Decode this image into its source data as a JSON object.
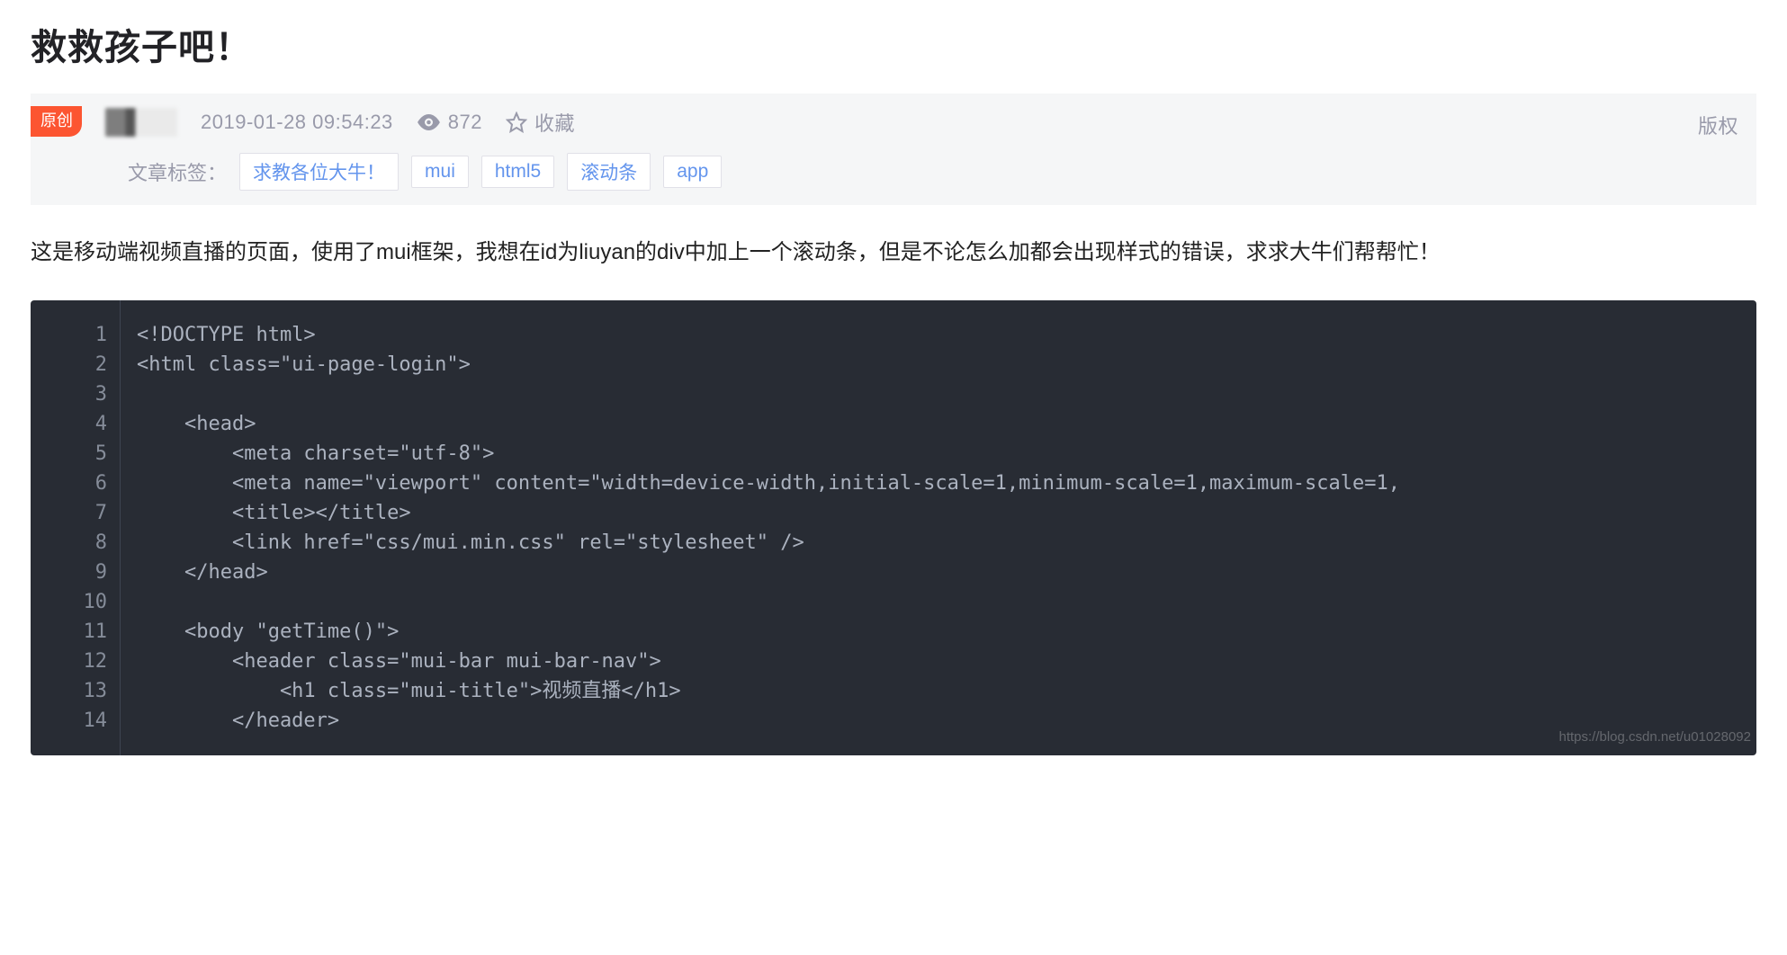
{
  "title": "救救孩子吧！",
  "meta": {
    "badge": "原创",
    "timestamp": "2019-01-28 09:54:23",
    "views": "872",
    "fav": "收藏",
    "copyright": "版权",
    "tags_label": "文章标签：",
    "tags": [
      "求教各位大牛！",
      "mui",
      "html5",
      "滚动条",
      "app"
    ]
  },
  "body": "这是移动端视频直播的页面，使用了mui框架，我想在id为liuyan的div中加上一个滚动条，但是不论怎么加都会出现样式的错误，求求大牛们帮帮忙！",
  "code": {
    "lines": [
      "<!DOCTYPE html>",
      "<html class=\"ui-page-login\">",
      "",
      "    <head>",
      "        <meta charset=\"utf-8\">",
      "        <meta name=\"viewport\" content=\"width=device-width,initial-scale=1,minimum-scale=1,maximum-scale=1,",
      "        <title></title>",
      "        <link href=\"css/mui.min.css\" rel=\"stylesheet\" />",
      "    </head>",
      "",
      "    <body \"getTime()\">",
      "        <header class=\"mui-bar mui-bar-nav\">",
      "            <h1 class=\"mui-title\">视频直播</h1>",
      "        </header>"
    ]
  },
  "watermark": "https://blog.csdn.net/u01028092"
}
